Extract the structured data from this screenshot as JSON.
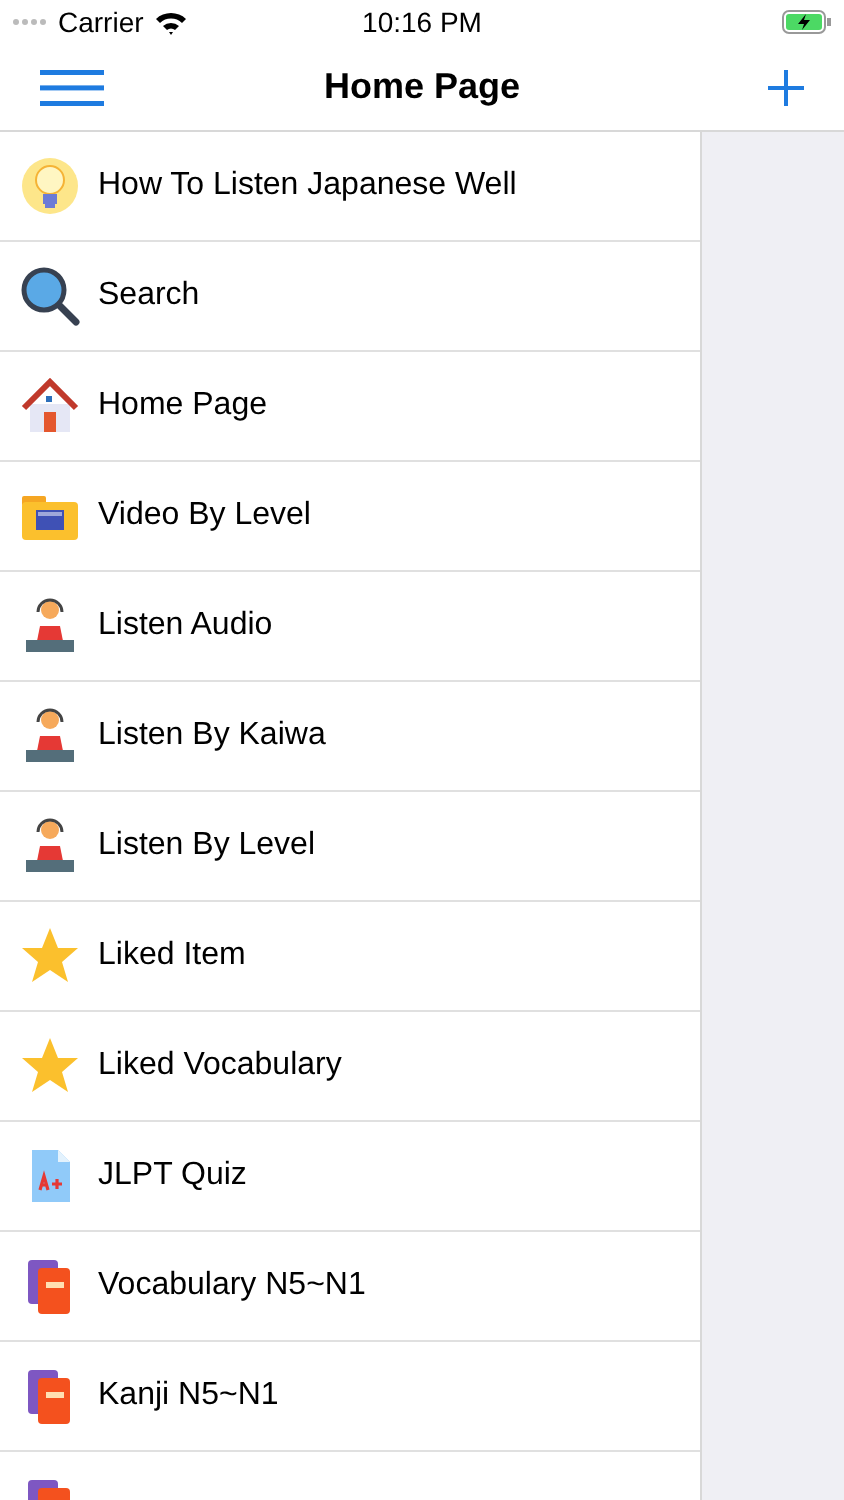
{
  "status_bar": {
    "carrier": "Carrier",
    "time": "10:16 PM"
  },
  "nav_bar": {
    "title": "Home Page"
  },
  "menu": [
    {
      "label": "How To Listen Japanese Well",
      "kind": "bulb"
    },
    {
      "label": "Search",
      "kind": "search"
    },
    {
      "label": "Home Page",
      "kind": "house"
    },
    {
      "label": "Video By Level",
      "kind": "video-folder"
    },
    {
      "label": "Listen Audio",
      "kind": "listener"
    },
    {
      "label": "Listen By Kaiwa",
      "kind": "listener"
    },
    {
      "label": "Listen By Level",
      "kind": "listener"
    },
    {
      "label": "Liked Item",
      "kind": "star"
    },
    {
      "label": "Liked Vocabulary",
      "kind": "star"
    },
    {
      "label": "JLPT Quiz",
      "kind": "quiz"
    },
    {
      "label": "Vocabulary N5~N1",
      "kind": "books"
    },
    {
      "label": "Kanji N5~N1",
      "kind": "books"
    },
    {
      "kind": "books"
    }
  ]
}
